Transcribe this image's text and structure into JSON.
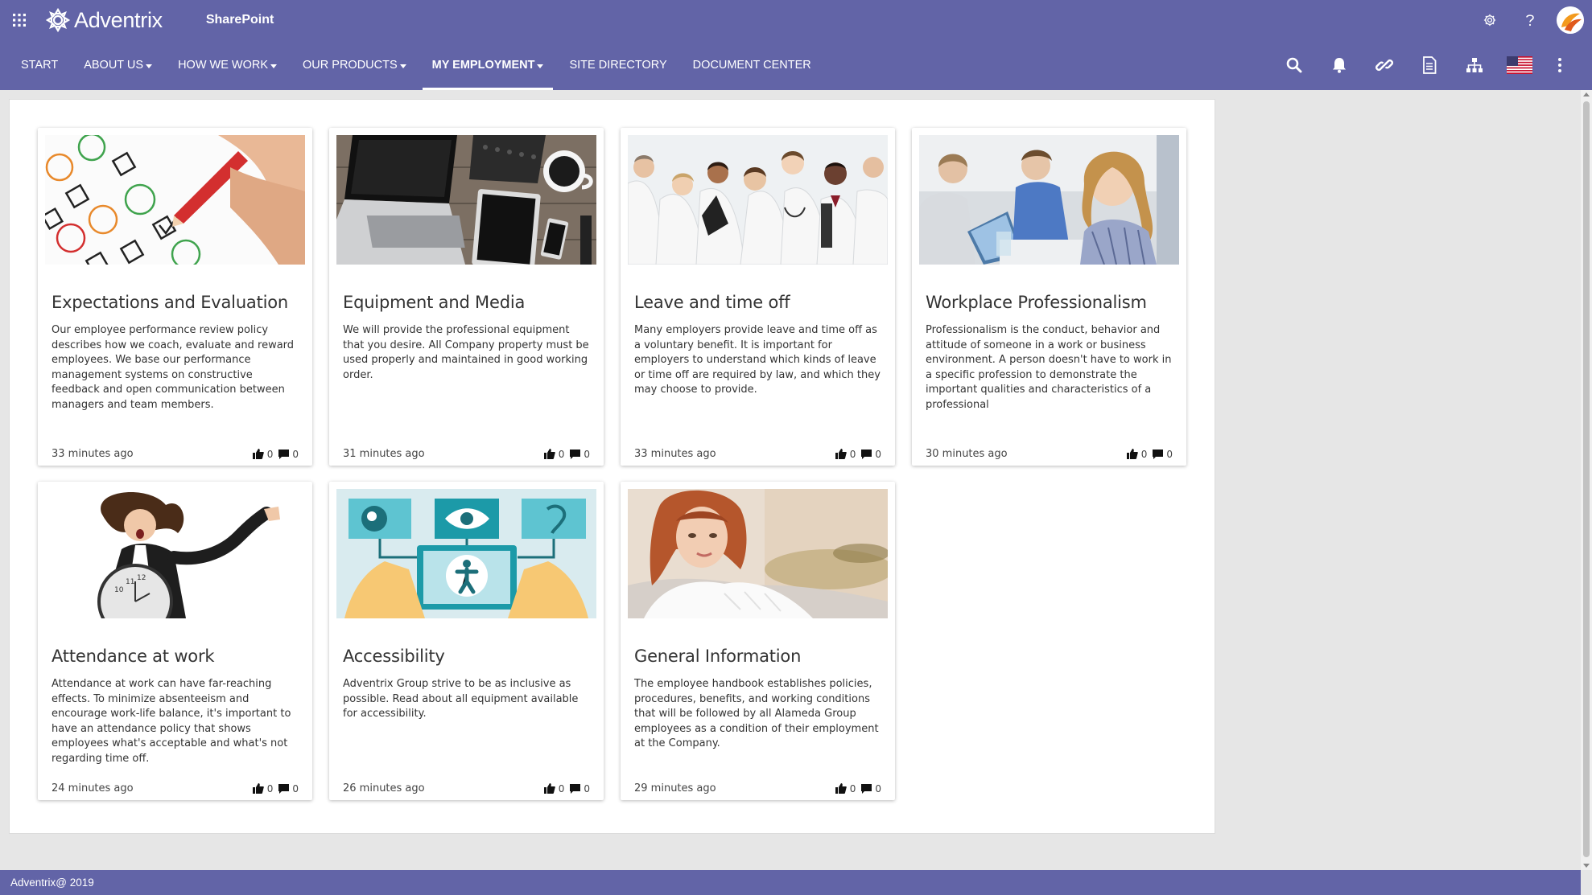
{
  "brand": {
    "logo_text": "Adventrix",
    "suite_title": "SharePoint",
    "accent_color": "#6264a7"
  },
  "suite_icons": [
    "settings-icon",
    "help-icon",
    "avatar"
  ],
  "nav": {
    "items": [
      {
        "label": "START",
        "dropdown": false,
        "active": false
      },
      {
        "label": "ABOUT US",
        "dropdown": true,
        "active": false
      },
      {
        "label": "HOW WE WORK",
        "dropdown": true,
        "active": false
      },
      {
        "label": "OUR PRODUCTS",
        "dropdown": true,
        "active": false
      },
      {
        "label": "MY EMPLOYMENT",
        "dropdown": true,
        "active": true
      },
      {
        "label": "SITE DIRECTORY",
        "dropdown": false,
        "active": false
      },
      {
        "label": "DOCUMENT CENTER",
        "dropdown": false,
        "active": false
      }
    ],
    "icons": [
      "search-icon",
      "bell-icon",
      "link-icon",
      "document-icon",
      "sitemap-icon",
      "us-flag-icon",
      "more-vertical-icon"
    ]
  },
  "cards": [
    {
      "title": "Expectations and Evaluation",
      "description": "Our employee performance review policy describes how we coach, evaluate and reward employees. We base our performance management systems on constructive feedback and open communication between managers and team members.",
      "time": "33 minutes ago",
      "likes": "0",
      "comments": "0"
    },
    {
      "title": "Equipment and Media",
      "description": "We will provide the professional equipment that you desire. All Company property must be used properly and maintained in good working order.",
      "time": "31 minutes ago",
      "likes": "0",
      "comments": "0"
    },
    {
      "title": "Leave and time off",
      "description": "Many employers provide leave and time off as a voluntary benefit. It is important for employers to understand which kinds of leave or time off are required by law, and which they may choose to provide.",
      "time": "33 minutes ago",
      "likes": "0",
      "comments": "0"
    },
    {
      "title": "Workplace Professionalism",
      "description": "Professionalism is the conduct, behavior and attitude of someone in a work or business environment. A person doesn't have to work in a specific profession to demonstrate the important qualities and characteristics of a professional",
      "time": "30 minutes ago",
      "likes": "0",
      "comments": "0"
    },
    {
      "title": "Attendance at work",
      "description": "Attendance at work can have far-reaching effects. To minimize absenteeism and encourage work-life balance, it's important to have an attendance policy that shows employees what's acceptable and what's not regarding time off.",
      "time": "24 minutes ago",
      "likes": "0",
      "comments": "0"
    },
    {
      "title": "Accessibility",
      "description": "Adventrix Group strive to be as inclusive as possible. Read about all equipment available for accessibility.",
      "time": "26 minutes ago",
      "likes": "0",
      "comments": "0"
    },
    {
      "title": "General Information",
      "description": "The employee handbook establishes policies, procedures, benefits, and working conditions that will be followed by all Alameda Group employees as a condition of their employment at the Company.",
      "time": "29 minutes ago",
      "likes": "0",
      "comments": "0"
    }
  ],
  "footer": {
    "copyright": "Adventrix@ 2019"
  }
}
